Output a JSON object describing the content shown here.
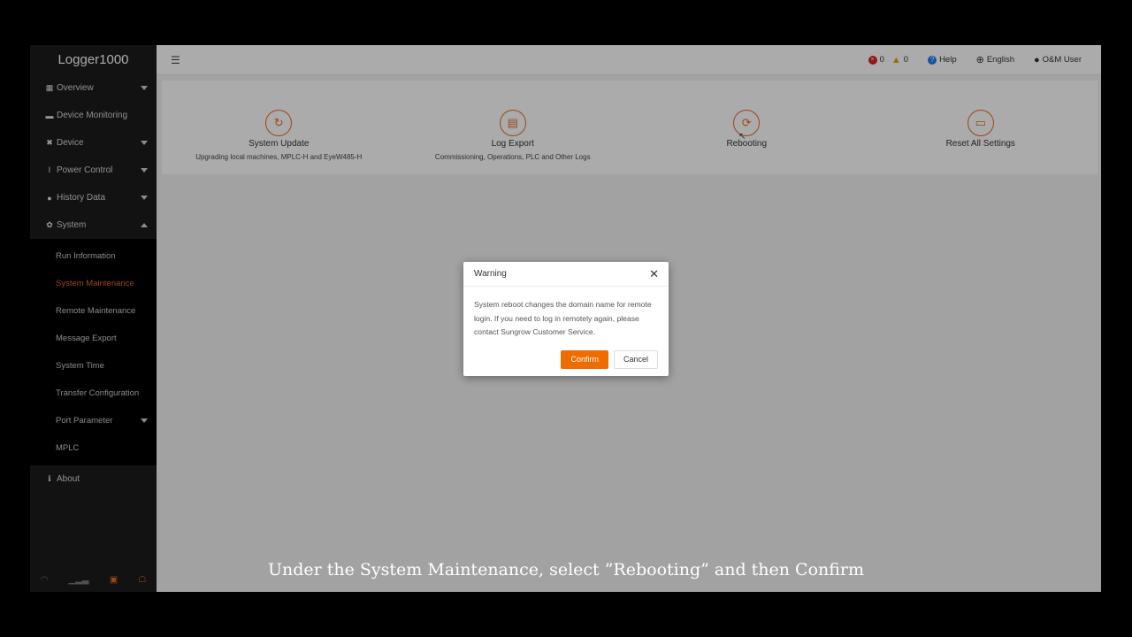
{
  "app": {
    "title": "Logger1000"
  },
  "sidebar": {
    "items": [
      {
        "label": "Overview",
        "icon": "grid-icon",
        "expandable": true
      },
      {
        "label": "Device Monitoring",
        "icon": "monitor-icon",
        "expandable": false
      },
      {
        "label": "Device",
        "icon": "wrench-icon",
        "expandable": true
      },
      {
        "label": "Power Control",
        "icon": "power-icon",
        "expandable": true
      },
      {
        "label": "History Data",
        "icon": "clock-icon",
        "expandable": true
      },
      {
        "label": "System",
        "icon": "gear-icon",
        "expandable": true,
        "expanded": true
      }
    ],
    "system_sub": [
      {
        "label": "Run Information"
      },
      {
        "label": "System Maintenance",
        "active": true
      },
      {
        "label": "Remote Maintenance"
      },
      {
        "label": "Message Export"
      },
      {
        "label": "System Time"
      },
      {
        "label": "Transfer Configuration"
      },
      {
        "label": "Port Parameter",
        "expandable": true
      },
      {
        "label": "MPLC"
      }
    ],
    "about": {
      "label": "About",
      "icon": "info-icon"
    },
    "footer_icons": [
      "wifi-icon",
      "signal-icon",
      "device-icon",
      "cloud-icon"
    ]
  },
  "header": {
    "error_count": "0",
    "warning_count": "0",
    "help_label": "Help",
    "language_label": "English",
    "user_label": "O&M User"
  },
  "tools": [
    {
      "title": "System Update",
      "desc": "Upgrading local machines, MPLC-H and EyeW485-H",
      "icon": "update-icon"
    },
    {
      "title": "Log Export",
      "desc": "Commissioning, Operations, PLC and Other Logs",
      "icon": "log-icon"
    },
    {
      "title": "Rebooting",
      "desc": "",
      "icon": "reboot-icon"
    },
    {
      "title": "Reset All Settings",
      "desc": "",
      "icon": "reset-icon"
    }
  ],
  "dialog": {
    "title": "Warning",
    "message": "System reboot changes the domain name for remote login. If you need to log in remotely again, please contact Sungrow Customer Service.",
    "confirm_label": "Confirm",
    "cancel_label": "Cancel"
  },
  "caption": "Under the System Maintenance, select ”Rebooting” and then Confirm",
  "colors": {
    "accent": "#ef6c00",
    "sidebar": "#1b1b1b",
    "active_text": "#e8672a"
  }
}
